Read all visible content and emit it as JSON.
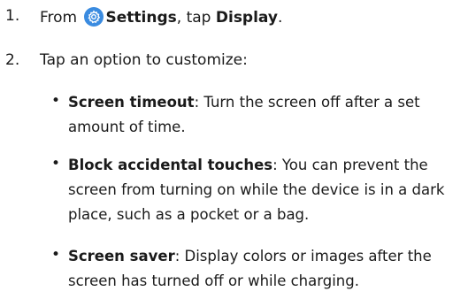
{
  "steps": [
    {
      "number": "1.",
      "prefix": "From",
      "settings_label": "Settings",
      "middle": ", tap",
      "display_label": "Display",
      "suffix": "."
    },
    {
      "number": "2.",
      "text": "Tap an option to customize:"
    }
  ],
  "bullets": [
    {
      "term": "Screen timeout",
      "description": ": Turn the screen off after a set amount of time."
    },
    {
      "term": "Block accidental touches",
      "description": ": You can prevent the screen from turning on while the device is in a dark place, such as a pocket or a bag."
    },
    {
      "term": "Screen saver",
      "description": ": Display colors or images after the screen has turned off or while charging."
    }
  ],
  "icons": {
    "settings": "gear-icon"
  },
  "colors": {
    "settings_icon": "#3a8be0",
    "text": "#1a1a1a"
  }
}
